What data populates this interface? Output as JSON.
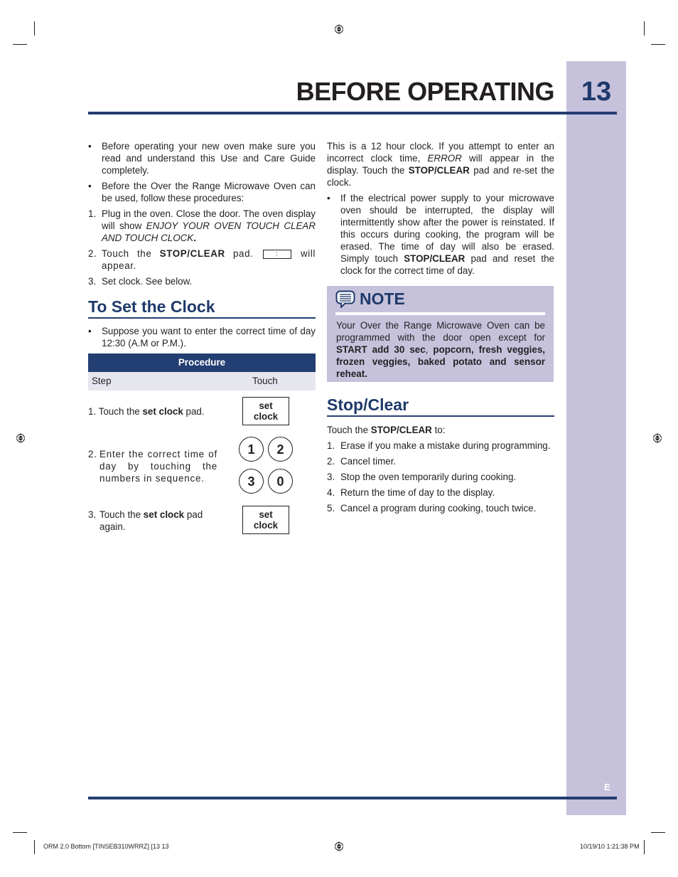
{
  "header": {
    "title": "BEFORE OPERATING",
    "page_number": "13"
  },
  "left_column": {
    "bullets": [
      "Before operating your new oven make sure you read and understand this Use and Care Guide completely.",
      "Before the Over the Range Microwave Oven can be used, follow these procedures:"
    ],
    "steps": [
      {
        "num": "1.",
        "text_before": "Plug in the oven. Close the door. The oven display will show ",
        "italic": "ENJOY YOUR OVEN TOUCH CLEAR AND TOUCH CLOCK",
        "text_after": "."
      },
      {
        "num": "2.",
        "text_before": "Touch the ",
        "bold": "STOP/CLEAR",
        "text_mid": " pad.",
        "display_glyph": ":",
        "text_after": " will appear."
      },
      {
        "num": "3.",
        "text": "Set clock. See below."
      }
    ],
    "set_clock": {
      "heading": "To Set the Clock",
      "bullet": "Suppose you want to enter the correct time of day 12:30 (A.M or P.M.).",
      "table": {
        "title": "Procedure",
        "col_step": "Step",
        "col_touch": "Touch",
        "rows": [
          {
            "num": "1.",
            "before": "Touch the ",
            "bold": "set clock",
            "after": " pad.",
            "pad": [
              "set",
              "clock"
            ]
          },
          {
            "num": "2.",
            "text": "Enter the correct time of day by touching the numbers in sequence.",
            "keys": [
              "1",
              "2",
              "3",
              "0"
            ]
          },
          {
            "num": "3.",
            "before": "Touch the ",
            "bold": "set clock",
            "after": " pad again.",
            "pad": [
              "set",
              "clock"
            ]
          }
        ]
      }
    }
  },
  "right_column": {
    "intro": {
      "p1": "This is a 12 hour clock. If you attempt to enter an incorrect clock time, ",
      "italic": "ERROR",
      "p2": " will appear in the display. Touch the ",
      "bold": "STOP/CLEAR",
      "p3": " pad and re-set the clock."
    },
    "bullet": {
      "p1": "If the electrical power supply to your microwave oven should be interrupted, the display will intermittently show after the power is reinstated. If this occurs during cooking, the program will be erased. The time of day will also be erased. Simply touch ",
      "bold": "STOP/CLEAR",
      "p2": " pad and reset the clock for the correct time of day."
    },
    "note": {
      "title": "NOTE",
      "text": "Your Over the Range Microwave Oven can be programmed with the door open except for ",
      "bold1": "START add 30 sec",
      "sep": ", ",
      "bold2": "popcorn, fresh veggies, frozen veggies, baked potato and sensor reheat."
    },
    "stop_clear": {
      "heading": "Stop/Clear",
      "intro_before": "Touch the ",
      "intro_bold": "STOP/CLEAR",
      "intro_after": " to:",
      "items": [
        {
          "num": "1.",
          "text": "Erase if you make a mistake during programming."
        },
        {
          "num": "2.",
          "text": "Cancel timer."
        },
        {
          "num": "3.",
          "text": "Stop the oven temporarily during cooking."
        },
        {
          "num": "4.",
          "text": "Return the time of day to the display."
        },
        {
          "num": "5.",
          "text": "Cancel a program during cooking, touch twice."
        }
      ]
    }
  },
  "sidebar": {
    "language": "E"
  },
  "print_footer": {
    "left": "ORM 2.0 Bottom [TINSEB310WRRZ] [13   13",
    "right": "10/19/10   1:21:38 PM"
  },
  "colors": {
    "brand_blue": "#233e72",
    "heading_blue": "#1f3a6b",
    "sidebar_lavender": "#c6c2dc"
  }
}
